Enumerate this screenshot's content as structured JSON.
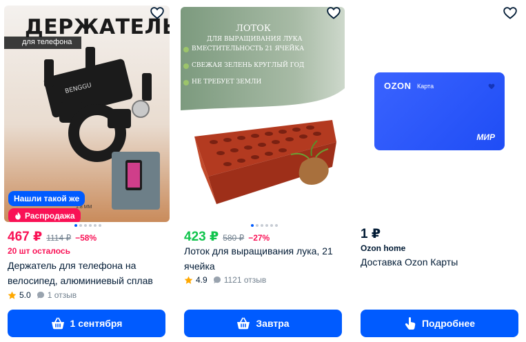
{
  "products": [
    {
      "image": {
        "headline": "ДЕРЖАТЕЛЬ",
        "subline": "для телефона",
        "brand_mark": "BENGGU",
        "size_mark_1": "8",
        "size_mark_2": "1.8 MM"
      },
      "badges": {
        "found_label": "Нашли такой же",
        "sale_label": "Распродажа"
      },
      "price": "467 ₽",
      "old_price": "1114 ₽",
      "discount": "−58%",
      "stock": "20 шт осталось",
      "title": "Держатель для телефона на велосипед, алюминиевый сплав",
      "rating": "5.0",
      "reviews": "1 отзыв",
      "button_label": "1 сентября",
      "button_icon": "basket-icon"
    },
    {
      "image": {
        "headline": "ЛОТОК",
        "subline": "ДЛЯ ВЫРАЩИВАНИЯ ЛУКА",
        "feature_1": "ВМЕСТИТЕЛЬНОСТЬ 21 ЯЧЕЙКА",
        "feature_2": "СВЕЖАЯ ЗЕЛЕНЬ КРУГЛЫЙ ГОД",
        "feature_3": "НЕ ТРЕБУЕТ ЗЕМЛИ"
      },
      "price": "423 ₽",
      "old_price": "580 ₽",
      "discount": "−27%",
      "title": "Лоток для выращивания лука, 21 ячейка",
      "rating": "4.9",
      "reviews": "1121 отзыв",
      "button_label": "Завтра",
      "button_icon": "basket-icon"
    },
    {
      "image": {
        "brand": "OZON",
        "card_label": "Карта",
        "payment_system": "МИР"
      },
      "price": "1 ₽",
      "seller": "Ozon home",
      "title": "Доставка Ozon Карты",
      "button_label": "Подробнее",
      "button_icon": "tap-icon"
    }
  ],
  "colors": {
    "accent": "#005bff",
    "sale": "#f91155",
    "green_price": "#10c44c",
    "text": "#001a34",
    "muted": "#707f8d",
    "star": "#ffa800"
  }
}
